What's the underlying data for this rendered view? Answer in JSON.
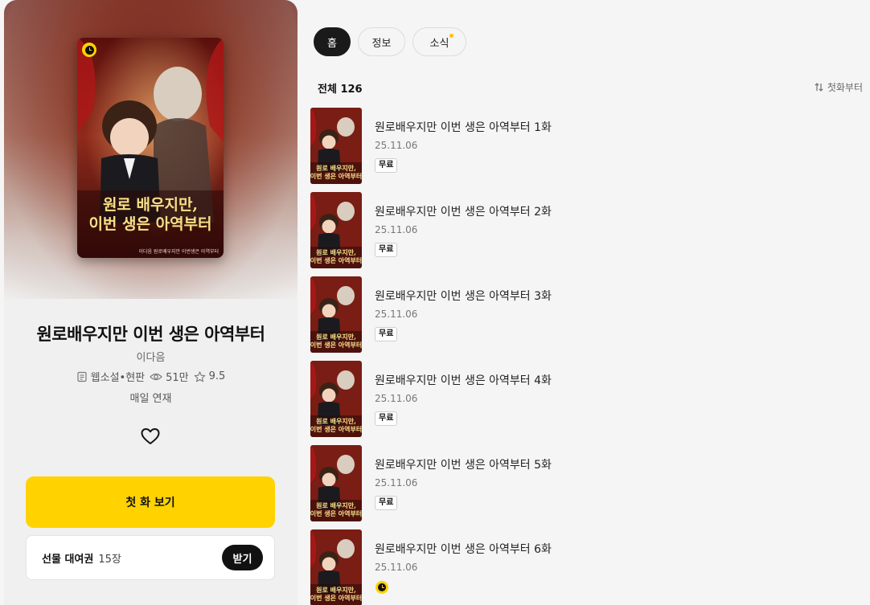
{
  "series": {
    "title": "원로배우지만 이번 생은 아역부터",
    "author": "이다음",
    "genre": "웹소설•현판",
    "views": "51만",
    "rating": "9.5",
    "schedule": "매일 연재",
    "cover_title_line1": "원로 배우지만,",
    "cover_title_line2": "이번 생은 아역부터",
    "cover_credit": "이다음 원로배우지만 이번생은 아역부터"
  },
  "actions": {
    "first_episode_label": "첫 화 보기",
    "gift_label": "선물 대여권",
    "gift_count": "15장",
    "receive_label": "받기"
  },
  "tabs": [
    {
      "label": "홈",
      "active": true
    },
    {
      "label": "정보",
      "active": false
    },
    {
      "label": "소식",
      "active": false,
      "has_dot": true
    }
  ],
  "list": {
    "total_label": "전체 126",
    "sort_label": "첫화부터"
  },
  "episodes": [
    {
      "title": "원로배우지만 이번 생은 아역부터 1화",
      "date": "25.11.06",
      "badge": "무료"
    },
    {
      "title": "원로배우지만 이번 생은 아역부터 2화",
      "date": "25.11.06",
      "badge": "무료"
    },
    {
      "title": "원로배우지만 이번 생은 아역부터 3화",
      "date": "25.11.06",
      "badge": "무료"
    },
    {
      "title": "원로배우지만 이번 생은 아역부터 4화",
      "date": "25.11.06",
      "badge": "무료"
    },
    {
      "title": "원로배우지만 이번 생은 아역부터 5화",
      "date": "25.11.06",
      "badge": "무료"
    },
    {
      "title": "원로배우지만 이번 생은 아역부터 6화",
      "date": "25.11.06",
      "badge": "wait-free-clock-icon"
    }
  ],
  "colors": {
    "accent": "#ffd200",
    "dark": "#111111",
    "new_dot": "#ffc400"
  }
}
